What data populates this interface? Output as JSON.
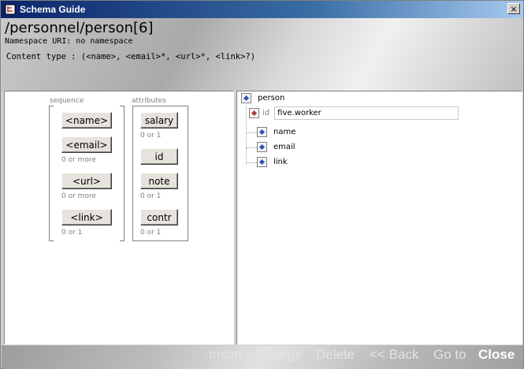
{
  "window": {
    "title": "Schema Guide",
    "close_glyph": "×"
  },
  "header": {
    "path": "/personnel/person[6]",
    "namespace": "Namespace URI: no namespace",
    "content_type": "Content type : (<name>, <email>*, <url>*, <link>?)"
  },
  "left": {
    "sequence_label": "sequence",
    "attributes_label": "attributes",
    "elements": [
      {
        "label": "<name>",
        "occurrence": ""
      },
      {
        "label": "<email>",
        "occurrence": "0 or more"
      },
      {
        "label": "<url>",
        "occurrence": "0 or more"
      },
      {
        "label": "<link>",
        "occurrence": "0 or 1"
      }
    ],
    "attributes": [
      {
        "label": "salary",
        "occurrence": "0 or 1"
      },
      {
        "label": "id",
        "occurrence": ""
      },
      {
        "label": "note",
        "occurrence": "0 or 1"
      },
      {
        "label": "contr",
        "occurrence": "0 or 1"
      }
    ]
  },
  "tree": {
    "root": "person",
    "attribute": {
      "name": "id",
      "value": "five.worker"
    },
    "children": [
      "name",
      "email",
      "link"
    ]
  },
  "footer": {
    "insert": "Insert",
    "change": "Change",
    "delete": "Delete",
    "back": "<< Back",
    "goto": "Go to",
    "close": "Close"
  },
  "icons": {
    "app": "app-icon",
    "element": "element-node-icon",
    "attribute": "attribute-node-icon"
  },
  "colors": {
    "title_bar": "#0a246a",
    "element_icon": "#2a55b5",
    "attribute_icon": "#b03a3a"
  }
}
